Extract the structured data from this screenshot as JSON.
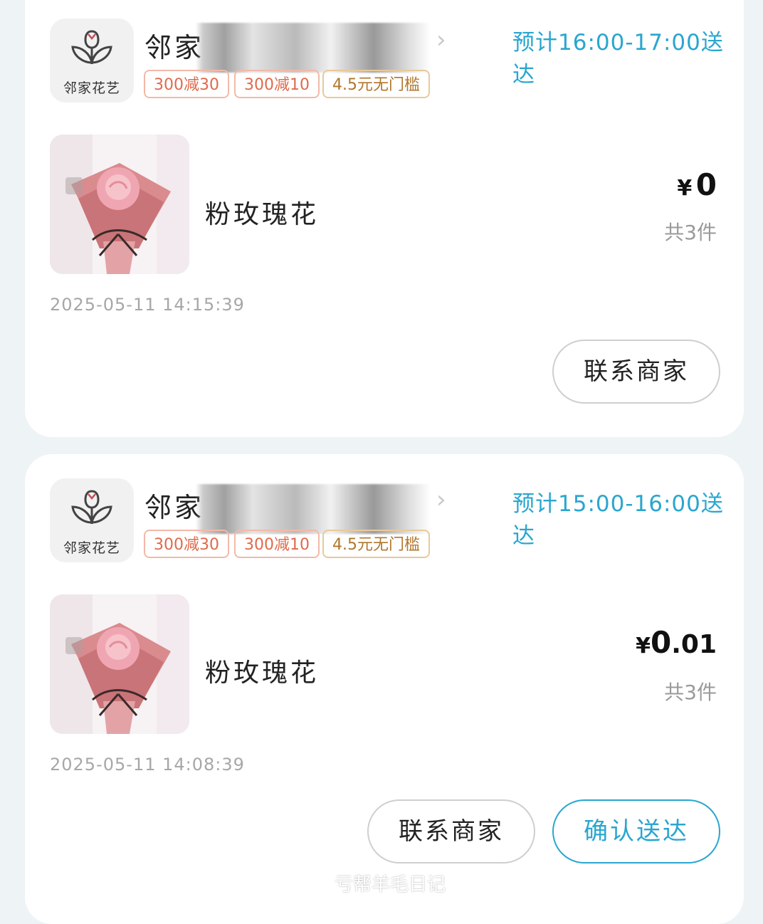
{
  "orders": [
    {
      "logo_text": "邻家花艺",
      "shop_name": "邻家",
      "delivery": "预计16:00-17:00送达",
      "tags": [
        "300减30",
        "300减10",
        "4.5元无门槛"
      ],
      "product_name": "粉玫瑰花",
      "price_currency": "¥",
      "price_int": "0",
      "price_dec": "",
      "quantity": "共3件",
      "time": "2025-05-11 14:15:39",
      "contact_label": "联系商家"
    },
    {
      "logo_text": "邻家花艺",
      "shop_name": "邻家",
      "delivery": "预计15:00-16:00送达",
      "tags": [
        "300减30",
        "300减10",
        "4.5元无门槛"
      ],
      "product_name": "粉玫瑰花",
      "price_currency": "¥",
      "price_int": "0",
      "price_dec": ".01",
      "quantity": "共3件",
      "time": "2025-05-11 14:08:39",
      "contact_label": "联系商家",
      "confirm_label": "确认送达"
    }
  ],
  "watermark": "亏帮羊毛日记",
  "colors": {
    "accent": "#2aa6cf",
    "tag_red": "#e06a4c",
    "tag_orange": "#b0762c",
    "background": "#eef3f6"
  }
}
